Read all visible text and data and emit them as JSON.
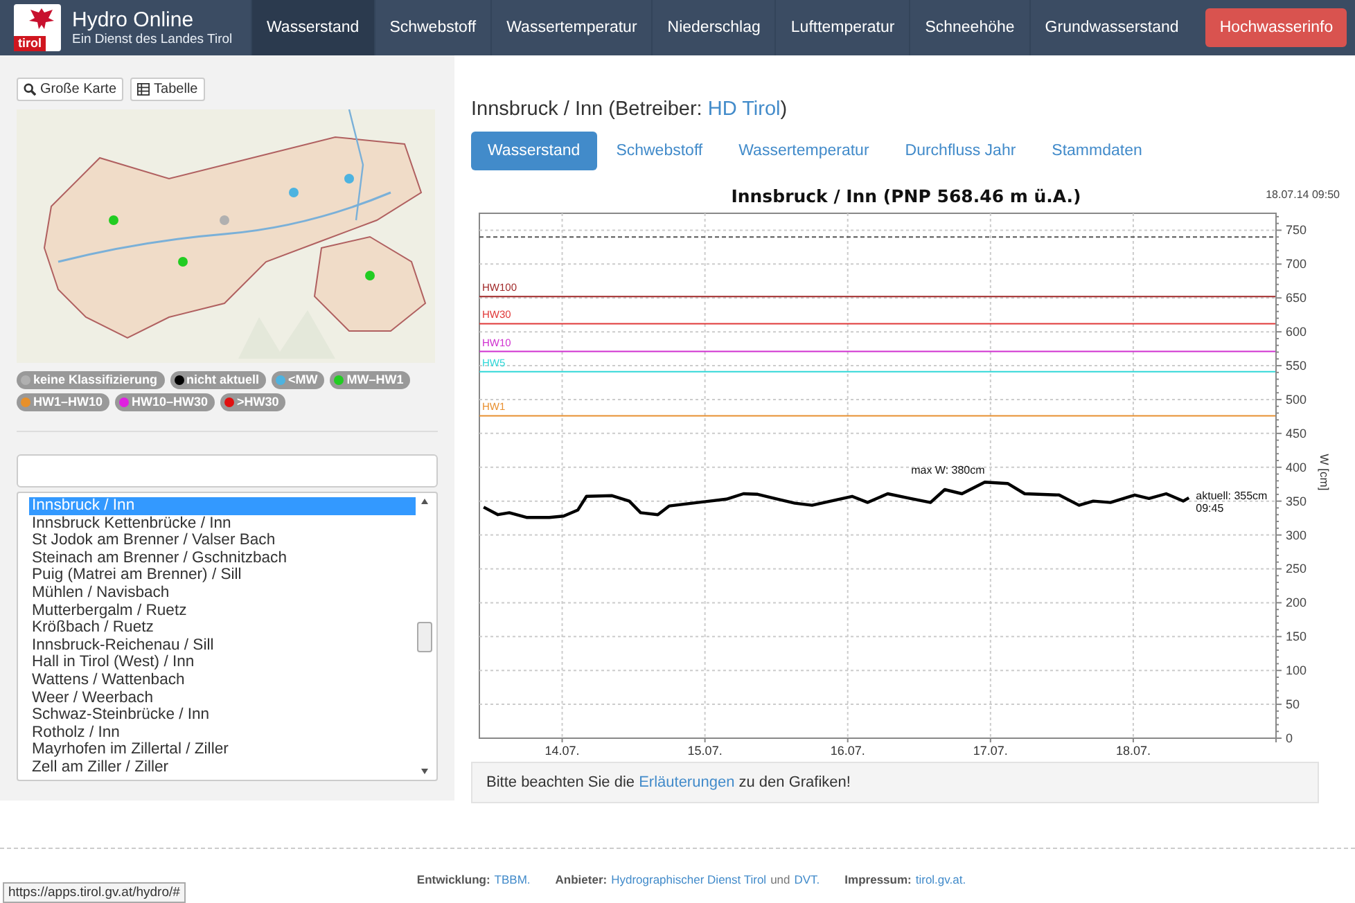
{
  "header": {
    "logo_text": "tirol",
    "title": "Hydro Online",
    "subtitle": "Ein Dienst des Landes Tirol"
  },
  "nav": [
    {
      "label": "Wasserstand",
      "selected": true,
      "kind": "tab"
    },
    {
      "label": "Schwebstoff",
      "selected": false,
      "kind": "tab"
    },
    {
      "label": "Wassertemperatur",
      "selected": false,
      "kind": "tab"
    },
    {
      "label": "Niederschlag",
      "selected": false,
      "kind": "tab"
    },
    {
      "label": "Lufttemperatur",
      "selected": false,
      "kind": "tab"
    },
    {
      "label": "Schneehöhe",
      "selected": false,
      "kind": "tab"
    },
    {
      "label": "Grundwasserstand",
      "selected": false,
      "kind": "tab"
    },
    {
      "label": "Hochwasserinfo",
      "selected": false,
      "kind": "alert"
    }
  ],
  "sidebar": {
    "buttons": [
      {
        "label": "Große Karte",
        "kind": "zoom"
      },
      {
        "label": "Tabelle",
        "kind": "table"
      }
    ],
    "legend": [
      {
        "label": "keine Klassifizierung",
        "color": "#b0b0b0"
      },
      {
        "label": "nicht aktuell",
        "color": "#000000"
      },
      {
        "label": "<MW",
        "color": "#4db3e0"
      },
      {
        "label": "MW–HW1",
        "color": "#22cc22"
      },
      {
        "label": "HW1–HW10",
        "color": "#e8902a"
      },
      {
        "label": "HW10–HW30",
        "color": "#e020e0"
      },
      {
        "label": ">HW30",
        "color": "#e01010"
      }
    ],
    "stations": [
      {
        "label": "Innsbruck / Inn",
        "selected": true
      },
      {
        "label": "Innsbruck Kettenbrücke / Inn",
        "selected": false
      },
      {
        "label": "St Jodok am Brenner / Valser Bach",
        "selected": false
      },
      {
        "label": "Steinach am Brenner / Gschnitzbach",
        "selected": false
      },
      {
        "label": "Puig (Matrei am Brenner) / Sill",
        "selected": false
      },
      {
        "label": "Mühlen / Navisbach",
        "selected": false
      },
      {
        "label": "Mutterbergalm / Ruetz",
        "selected": false
      },
      {
        "label": "Krößbach / Ruetz",
        "selected": false
      },
      {
        "label": "Innsbruck-Reichenau / Sill",
        "selected": false
      },
      {
        "label": "Hall in Tirol (West) / Inn",
        "selected": false
      },
      {
        "label": "Wattens / Wattenbach",
        "selected": false
      },
      {
        "label": "Weer / Weerbach",
        "selected": false
      },
      {
        "label": "Schwaz-Steinbrücke / Inn",
        "selected": false
      },
      {
        "label": "Rotholz / Inn",
        "selected": false
      },
      {
        "label": "Mayrhofen im Zillertal / Ziller",
        "selected": false
      },
      {
        "label": "Zell am Ziller / Ziller",
        "selected": false
      }
    ]
  },
  "main": {
    "title": "Innsbruck / Inn (Betreiber: ",
    "title_link": "HD Tirol",
    "title_end": ")",
    "tabs": [
      {
        "label": "Wasserstand",
        "selected": true
      },
      {
        "label": "Schwebstoff",
        "selected": false
      },
      {
        "label": "Wassertemperatur",
        "selected": false
      },
      {
        "label": "Durchfluss Jahr",
        "selected": false
      },
      {
        "label": "Stammdaten",
        "selected": false
      }
    ],
    "timestamp": "18.07.14 09:50",
    "chart_data": {
      "type": "line",
      "title": "Innsbruck / Inn (PNP 568.46 m ü.A.)",
      "ylabel": "W [cm]",
      "xlim": [
        13.49,
        19.07
      ],
      "ylim": [
        0,
        775
      ],
      "xticks": [
        {
          "value": 14.07,
          "label": "14.07."
        },
        {
          "value": 15.07,
          "label": "15.07."
        },
        {
          "value": 16.07,
          "label": "16.07."
        },
        {
          "value": 17.07,
          "label": "17.07."
        },
        {
          "value": 18.07,
          "label": "18.07."
        }
      ],
      "yticks": [
        0,
        50,
        100,
        150,
        200,
        250,
        300,
        350,
        400,
        450,
        500,
        550,
        600,
        650,
        700,
        750
      ],
      "x": [
        13.52,
        13.62,
        13.7,
        13.82,
        13.98,
        14.08,
        14.18,
        14.24,
        14.42,
        14.54,
        14.62,
        14.74,
        14.82,
        15.02,
        15.22,
        15.34,
        15.44,
        15.58,
        15.7,
        15.82,
        15.99,
        16.1,
        16.21,
        16.35,
        16.51,
        16.65,
        16.75,
        16.87,
        17.03,
        17.19,
        17.31,
        17.55,
        17.69,
        17.79,
        17.91,
        18.08,
        18.18,
        18.3,
        18.42,
        18.46
      ],
      "series": [
        {
          "color": "#000000",
          "values": [
            341,
            330,
            333,
            326,
            326,
            328,
            337,
            357,
            358,
            350,
            333,
            330,
            343,
            348,
            353,
            361,
            360,
            353,
            347,
            344,
            352,
            357,
            348,
            361,
            354,
            348,
            367,
            361,
            378,
            376,
            361,
            359,
            344,
            350,
            348,
            359,
            354,
            361,
            350,
            355
          ]
        }
      ],
      "grid": true,
      "ref_lines": [
        {
          "axis": "y",
          "value": 740,
          "color": "#555555"
        },
        {
          "axis": "y",
          "value": 652,
          "label": "HW100",
          "color": "#a02828"
        },
        {
          "axis": "y",
          "value": 612,
          "label": "HW30",
          "color": "#e03838"
        },
        {
          "axis": "y",
          "value": 571,
          "label": "HW10",
          "color": "#d030d0"
        },
        {
          "axis": "y",
          "value": 541,
          "label": "HW5",
          "color": "#30d8d8"
        },
        {
          "axis": "y",
          "value": 476,
          "label": "HW1",
          "color": "#e89030"
        }
      ],
      "annotations": [
        {
          "text": "max W: 380cm",
          "x": 17.03,
          "y": 378
        },
        {
          "text": "aktuell: 355cm",
          "x": 18.46,
          "y": 355
        },
        "09:45"
      ]
    },
    "note": {
      "text": "Bitte beachten Sie die ",
      "link": "Erläuterungen",
      "text_end": " zu den Grafiken!"
    }
  },
  "footer": [
    [
      {
        "text": "Entwicklung:",
        "kind": "label"
      },
      {
        "text": "TBBM.",
        "kind": "link"
      }
    ],
    [
      {
        "text": "Anbieter:",
        "kind": "label"
      },
      {
        "text": "Hydrographischer Dienst Tirol",
        "kind": "link"
      },
      {
        "text": "und",
        "kind": "text"
      },
      {
        "text": "DVT.",
        "kind": "link"
      }
    ],
    [
      {
        "text": "Impressum:",
        "kind": "label"
      },
      {
        "text": "tirol.gv.at.",
        "kind": "link"
      }
    ]
  ],
  "status_url": "https://apps.tirol.gv.at/hydro/#"
}
